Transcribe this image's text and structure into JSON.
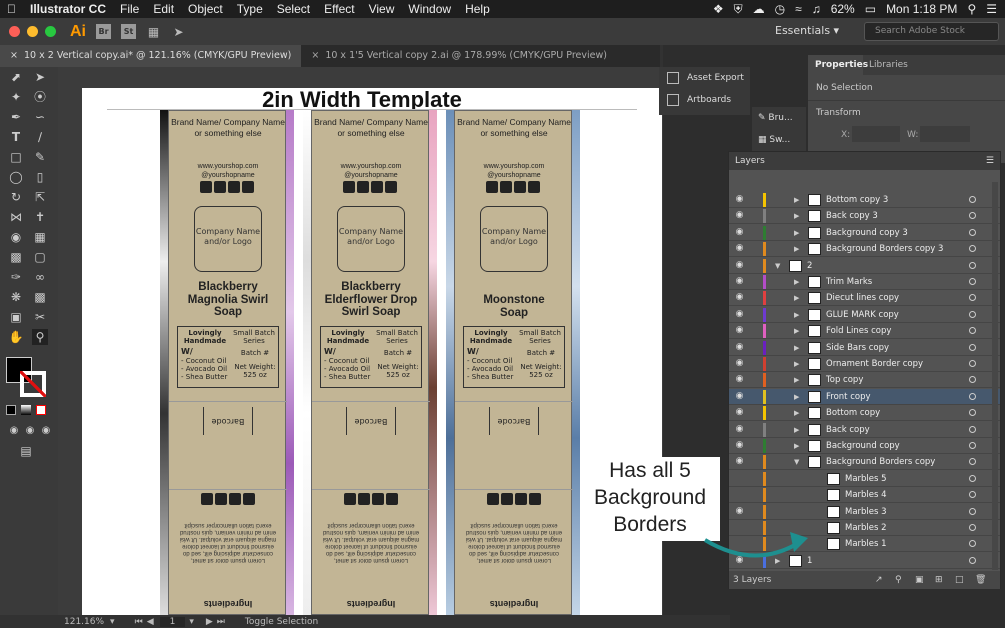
{
  "menubar": {
    "app": "Illustrator CC",
    "items": [
      "File",
      "Edit",
      "Object",
      "Type",
      "Select",
      "Effect",
      "View",
      "Window",
      "Help"
    ],
    "battery": "62%",
    "clock": "Mon 1:18 PM"
  },
  "appbar": {
    "logo": "Ai",
    "bridge": "Br",
    "stock": "St",
    "workspace": "Essentials",
    "search_placeholder": "Search Adobe Stock"
  },
  "tabs": [
    {
      "label": "10 x 2 Vertical copy.ai* @ 121.16% (CMYK/GPU Preview)"
    },
    {
      "label": "10 x 1'5 Vertical copy 2.ai @ 178.99% (CMYK/GPU Preview)"
    }
  ],
  "artboard": {
    "title": "2in Width Template",
    "brand": "Brand Name/ Company Name or something else",
    "web": "www.yourshop.com",
    "handle": "@yourshopname",
    "logo_text": "Company Name and/or Logo",
    "lovingly": "Lovingly Handmade",
    "batch_series": "Small Batch Series",
    "batch_no": "Batch #",
    "with": "W/",
    "ing1": "- Coconut Oil",
    "ing2": "- Avocado Oil",
    "ing3": "- Shea Butter",
    "net_weight": "Net Weight: 525 oz",
    "barcode": "Barcode",
    "ingredients": "Ingredients",
    "lorem": "Lorem ipsum dolor sit amet, consectetur adipiscing elit, sed do eiusmod tincidunt ut laoreet dolore magna aliquam erat volutpat. Ut wisi enim ad minim veniam, quis nostrud exerci tation ullamcorper suscipit",
    "products": [
      {
        "name": "Blackberry Magnolia Swirl Soap"
      },
      {
        "name": "Blackberry Elderflower Drop Swirl Soap"
      },
      {
        "name": "Moonstone Soap"
      }
    ]
  },
  "panels": {
    "asset_export": "Asset Export",
    "artboards": "Artboards",
    "brushes": "Bru...",
    "swatches": "Sw...",
    "properties_tab": "Properties",
    "libraries_tab": "Libraries",
    "no_selection": "No Selection",
    "transform": "Transform",
    "x_label": "X:",
    "w_label": "W:"
  },
  "layers": {
    "title": "Layers",
    "footer": "3 Layers",
    "rows": [
      {
        "name": "Bottom copy 3",
        "color": "#f5c400"
      },
      {
        "name": "Back copy 3",
        "color": "#808080"
      },
      {
        "name": "Background copy 3",
        "color": "#2e7d32"
      },
      {
        "name": "Background Borders copy 3",
        "color": "#e08a1e"
      },
      {
        "name": "2",
        "color": "#e08a1e"
      },
      {
        "name": "Trim Marks",
        "color": "#b34dc8"
      },
      {
        "name": "Diecut lines copy",
        "color": "#e04040"
      },
      {
        "name": "GLUE MARK copy",
        "color": "#6e3ad0"
      },
      {
        "name": "Fold Lines copy",
        "color": "#e060c0"
      },
      {
        "name": "Side Bars copy",
        "color": "#6a20c0"
      },
      {
        "name": "Ornament Border copy",
        "color": "#d04030"
      },
      {
        "name": "Top copy",
        "color": "#e06020"
      },
      {
        "name": "Front copy",
        "color": "#e0c020"
      },
      {
        "name": "Bottom copy",
        "color": "#f5c400"
      },
      {
        "name": "Back copy",
        "color": "#808080"
      },
      {
        "name": "Background copy",
        "color": "#2e7d32"
      },
      {
        "name": "Background Borders copy",
        "color": "#e08a1e"
      },
      {
        "name": "Marbles 5",
        "color": "#e08a1e"
      },
      {
        "name": "Marbles 4",
        "color": "#e08a1e"
      },
      {
        "name": "Marbles 3",
        "color": "#e08a1e"
      },
      {
        "name": "Marbles 2",
        "color": "#e08a1e"
      },
      {
        "name": "Marbles 1",
        "color": "#e08a1e"
      },
      {
        "name": "1",
        "color": "#4a6fe0"
      }
    ]
  },
  "annotation": "Has all 5 Background Borders",
  "status": {
    "zoom": "121.16%",
    "page": "1",
    "toggle": "Toggle Selection"
  }
}
